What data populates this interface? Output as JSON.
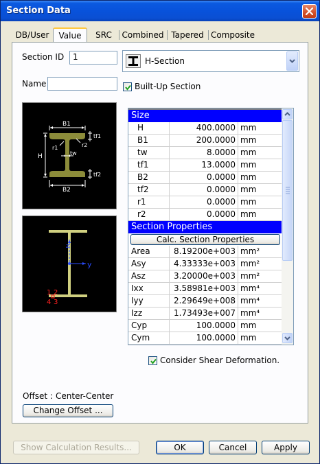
{
  "window": {
    "title": "Section Data"
  },
  "tabs": [
    {
      "label": "DB/User",
      "active": false
    },
    {
      "label": "Value",
      "active": true
    },
    {
      "label": "SRC",
      "active": false
    },
    {
      "label": "Combined",
      "active": false
    },
    {
      "label": "Tapered",
      "active": false
    },
    {
      "label": "Composite",
      "active": false
    }
  ],
  "section_id": {
    "label": "Section ID",
    "value": "1"
  },
  "name": {
    "label": "Name",
    "value": ""
  },
  "section_type": {
    "selected": "H-Section",
    "icon": "h-section-icon"
  },
  "built_up": {
    "label": "Built-Up Section",
    "checked": true
  },
  "diagram": {
    "labels": {
      "b1": "B1",
      "b2": "B2",
      "h": "H",
      "tf1": "tf1",
      "tf2": "tf2",
      "tw": "tw",
      "r1": "r1",
      "r2": "r2"
    },
    "axis": {
      "y": "y",
      "z": "z"
    },
    "points": {
      "p1": "1",
      "p2": "2",
      "p3": "3",
      "p4": "4"
    }
  },
  "grid": {
    "size_header": "Size",
    "size_rows": [
      {
        "name": "H",
        "value": "400.0000",
        "unit": "mm"
      },
      {
        "name": "B1",
        "value": "200.0000",
        "unit": "mm"
      },
      {
        "name": "tw",
        "value": "8.0000",
        "unit": "mm"
      },
      {
        "name": "tf1",
        "value": "13.0000",
        "unit": "mm"
      },
      {
        "name": "B2",
        "value": "0.0000",
        "unit": "mm"
      },
      {
        "name": "tf2",
        "value": "0.0000",
        "unit": "mm"
      },
      {
        "name": "r1",
        "value": "0.0000",
        "unit": "mm"
      },
      {
        "name": "r2",
        "value": "0.0000",
        "unit": "mm"
      }
    ],
    "props_header": "Section Properties",
    "calc_button": "Calc. Section Properties",
    "prop_rows": [
      {
        "name": "Area",
        "value": "8.19200e+003",
        "unit": "mm²"
      },
      {
        "name": "Asy",
        "value": "4.33333e+003",
        "unit": "mm²"
      },
      {
        "name": "Asz",
        "value": "3.20000e+003",
        "unit": "mm²"
      },
      {
        "name": "Ixx",
        "value": "3.58981e+003",
        "unit": "mm⁴"
      },
      {
        "name": "Iyy",
        "value": "2.29649e+008",
        "unit": "mm⁴"
      },
      {
        "name": "Izz",
        "value": "1.73493e+007",
        "unit": "mm⁴"
      },
      {
        "name": "Cyp",
        "value": "100.0000",
        "unit": "mm"
      },
      {
        "name": "Cym",
        "value": "100.0000",
        "unit": "mm"
      }
    ]
  },
  "shear": {
    "label": "Consider Shear Deformation.",
    "checked": true
  },
  "offset": {
    "label": "Offset :",
    "value": "Center-Center",
    "button": "Change Offset ..."
  },
  "footer": {
    "show_results": "Show Calculation Results...",
    "ok": "OK",
    "cancel": "Cancel",
    "apply": "Apply"
  },
  "colors": {
    "title_blue": "#0852db",
    "grid_header": "#0000ff",
    "section_fill": "#8c8c3a",
    "point_red": "#ff2020"
  }
}
